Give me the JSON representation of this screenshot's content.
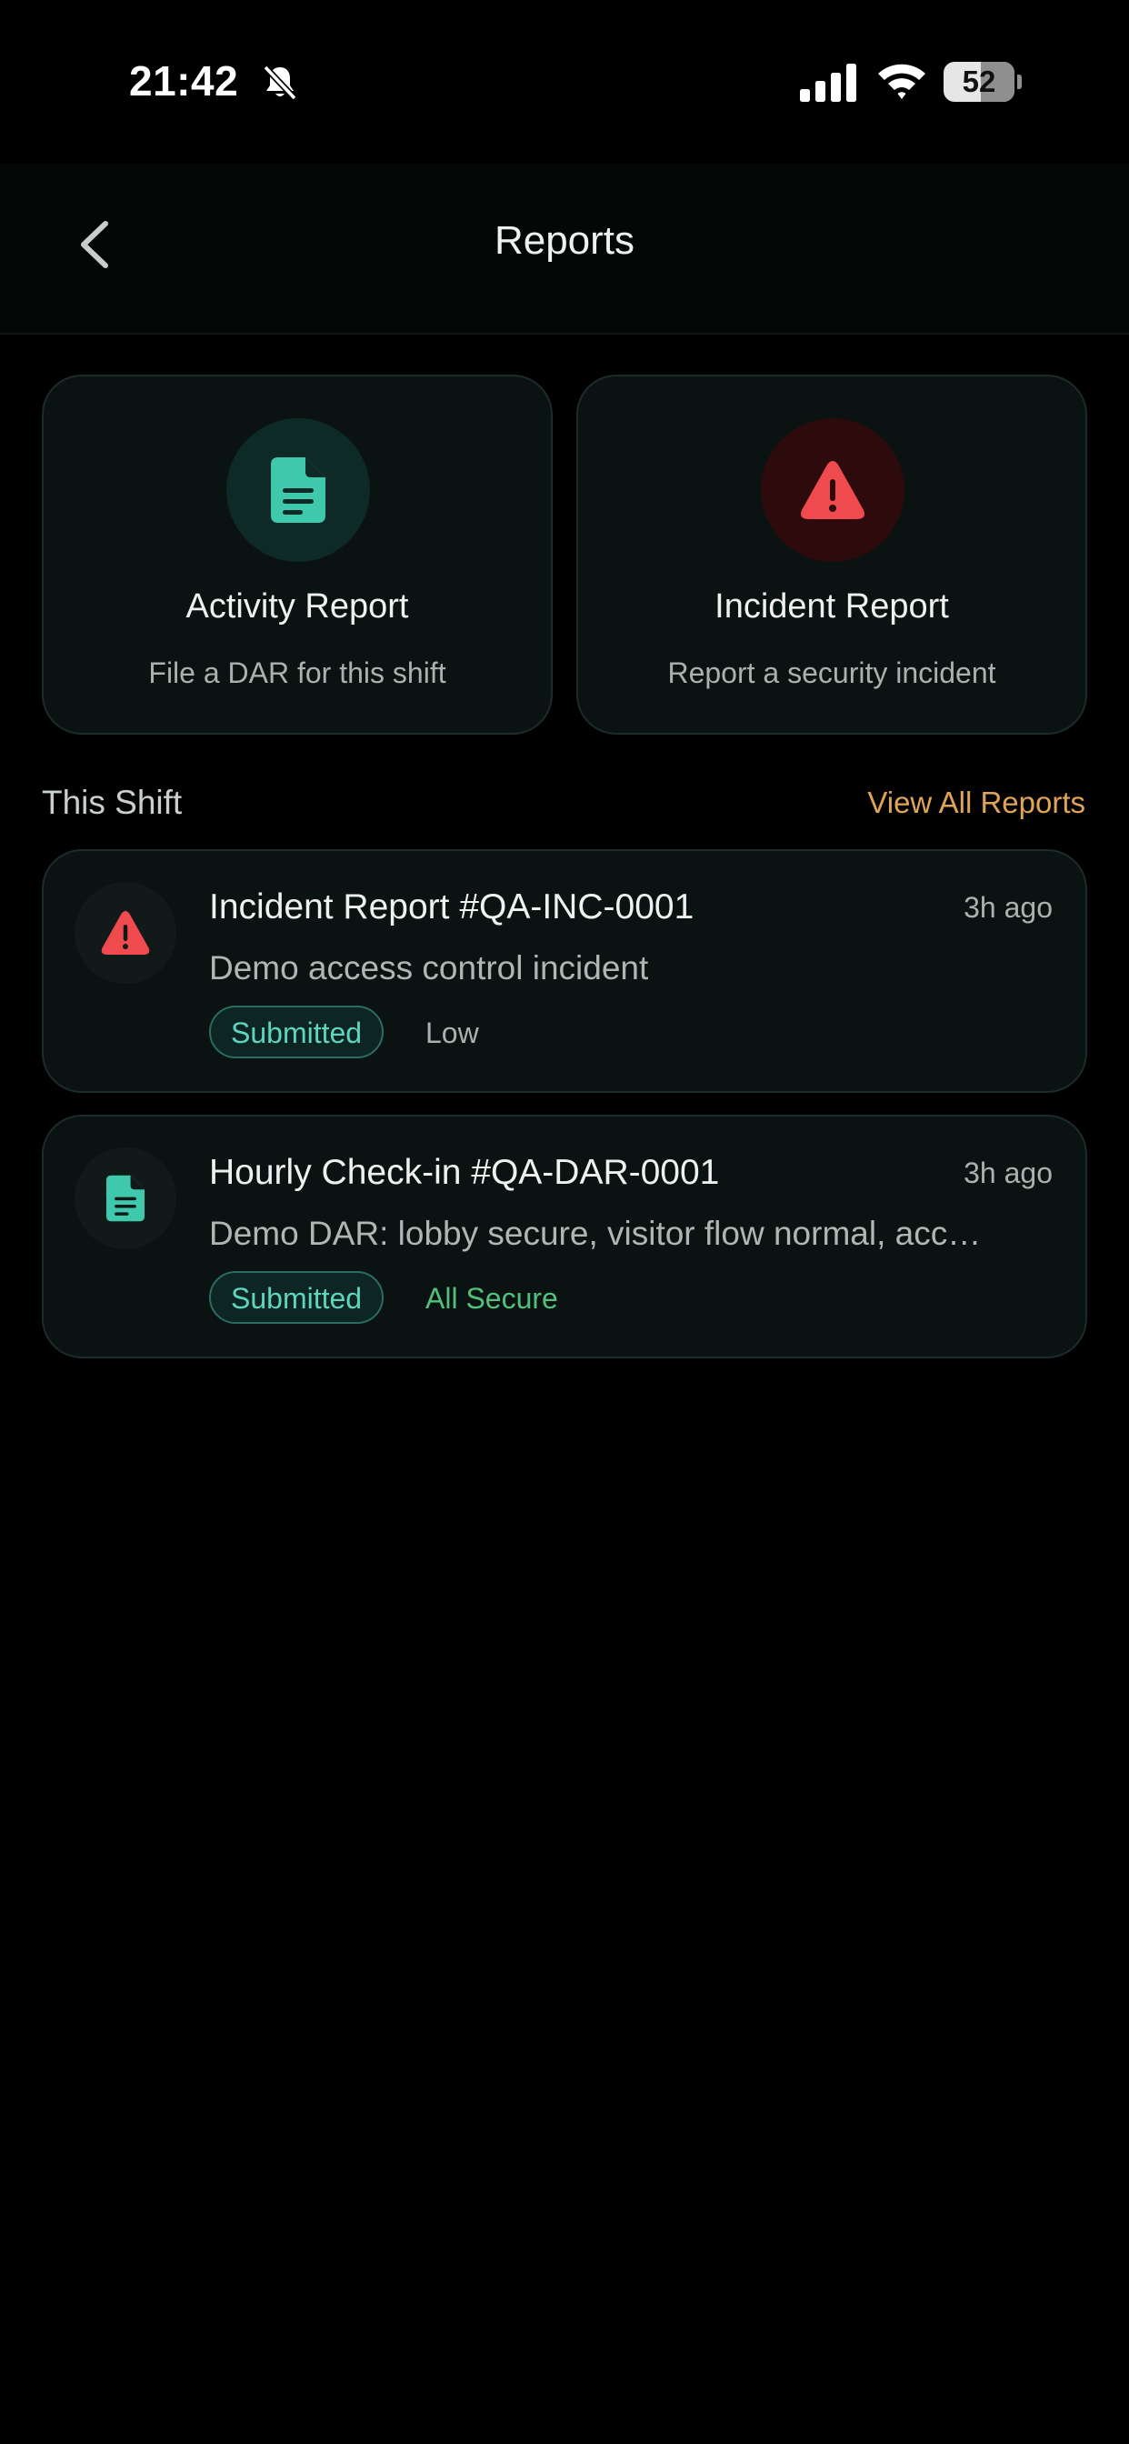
{
  "status_bar": {
    "time": "21:42",
    "battery": 52
  },
  "nav": {
    "title": "Reports"
  },
  "actions": [
    {
      "title": "Activity Report",
      "subtitle": "File a DAR for this shift",
      "icon": "document-icon",
      "accent": "#3ec9ad"
    },
    {
      "title": "Incident Report",
      "subtitle": "Report a security incident",
      "icon": "warning-icon",
      "accent": "#ef4b4e"
    }
  ],
  "section": {
    "title": "This Shift",
    "view_all_label": "View All Reports"
  },
  "reports": [
    {
      "title": "Incident Report #QA-INC-0001",
      "time": "3h ago",
      "description": "Demo access control incident",
      "status": "Submitted",
      "meta": "Low",
      "icon": "warning-icon"
    },
    {
      "title": "Hourly Check-in #QA-DAR-0001",
      "time": "3h ago",
      "description": "Demo DAR: lobby secure, visitor flow normal, acc…",
      "status": "Submitted",
      "meta": "All Secure",
      "icon": "document-icon"
    }
  ],
  "colors": {
    "background": "#000000",
    "card": "#0a1212",
    "teal_accent": "#3ec9ad",
    "danger": "#ef4b4e",
    "link": "#e0a458",
    "secure": "#52c07a"
  }
}
